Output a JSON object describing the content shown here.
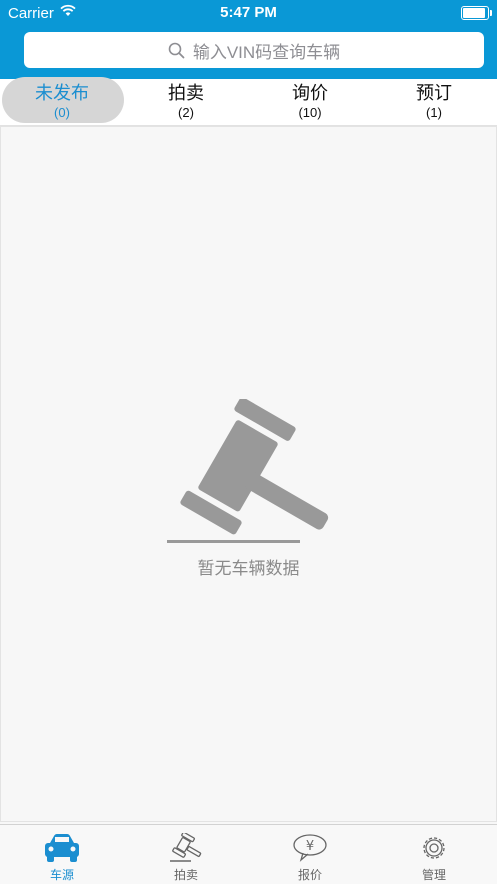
{
  "status": {
    "carrier": "Carrier",
    "time": "5:47 PM"
  },
  "search": {
    "placeholder": "输入VIN码查询车辆"
  },
  "tabs": [
    {
      "label": "未发布",
      "count": "(0)",
      "active": true
    },
    {
      "label": "拍卖",
      "count": "(2)",
      "active": false
    },
    {
      "label": "询价",
      "count": "(10)",
      "active": false
    },
    {
      "label": "预订",
      "count": "(1)",
      "active": false
    }
  ],
  "empty": {
    "message": "暂无车辆数据",
    "icon": "gavel-icon"
  },
  "tabbar": [
    {
      "label": "车源",
      "icon": "car-icon",
      "active": true
    },
    {
      "label": "拍卖",
      "icon": "gavel-icon",
      "active": false
    },
    {
      "label": "报价",
      "icon": "yen-bubble-icon",
      "active": false
    },
    {
      "label": "管理",
      "icon": "gear-icon",
      "active": false
    }
  ],
  "colors": {
    "header": "#0a98d6",
    "accent": "#1b8ed0",
    "active_tab_pill": "#d6d6d6"
  }
}
